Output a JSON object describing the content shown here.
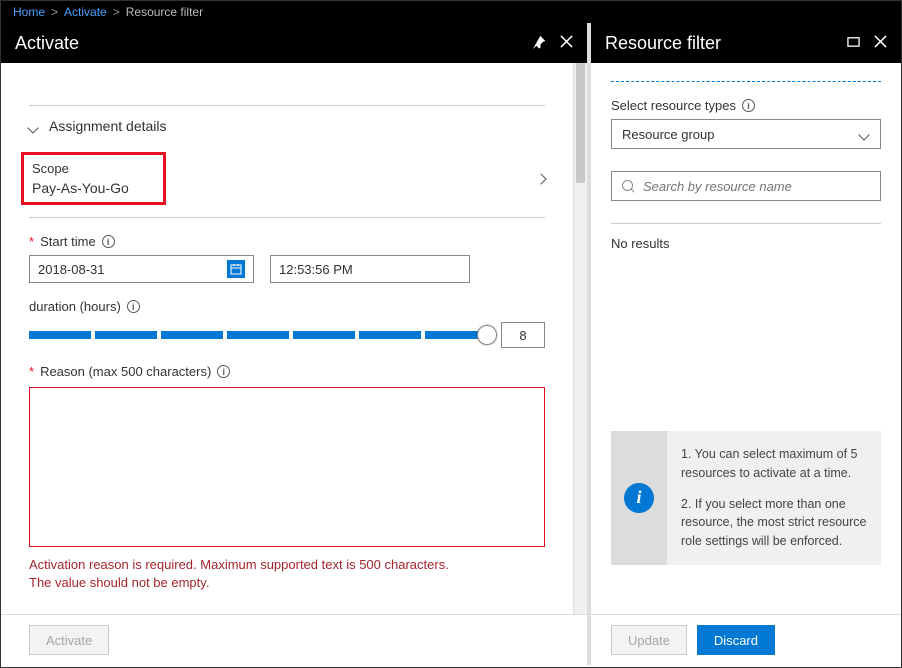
{
  "breadcrumb": {
    "home": "Home",
    "activate": "Activate",
    "current": "Resource filter"
  },
  "leftPanel": {
    "title": "Activate",
    "sectionTitle": "Assignment details",
    "scopeLabel": "Scope",
    "scopeValue": "Pay-As-You-Go",
    "startTimeLabel": "Start time",
    "dateValue": "2018-08-31",
    "timeValue": "12:53:56 PM",
    "durationLabel": "duration (hours)",
    "durationValue": "8",
    "reasonLabel": "Reason (max 500 characters)",
    "reasonValue": "",
    "errorLine1": "Activation reason is required. Maximum supported text is 500 characters.",
    "errorLine2": "The value should not be empty.",
    "activateBtn": "Activate"
  },
  "rightPanel": {
    "title": "Resource filter",
    "selectLabel": "Select resource types",
    "selectValue": "Resource group",
    "searchPlaceholder": "Search by resource name",
    "noResults": "No results",
    "info1": "1. You can select maximum of 5 resources to activate at a time.",
    "info2": "2. If you select more than one resource, the most strict resource role settings will be enforced.",
    "updateBtn": "Update",
    "discardBtn": "Discard"
  }
}
